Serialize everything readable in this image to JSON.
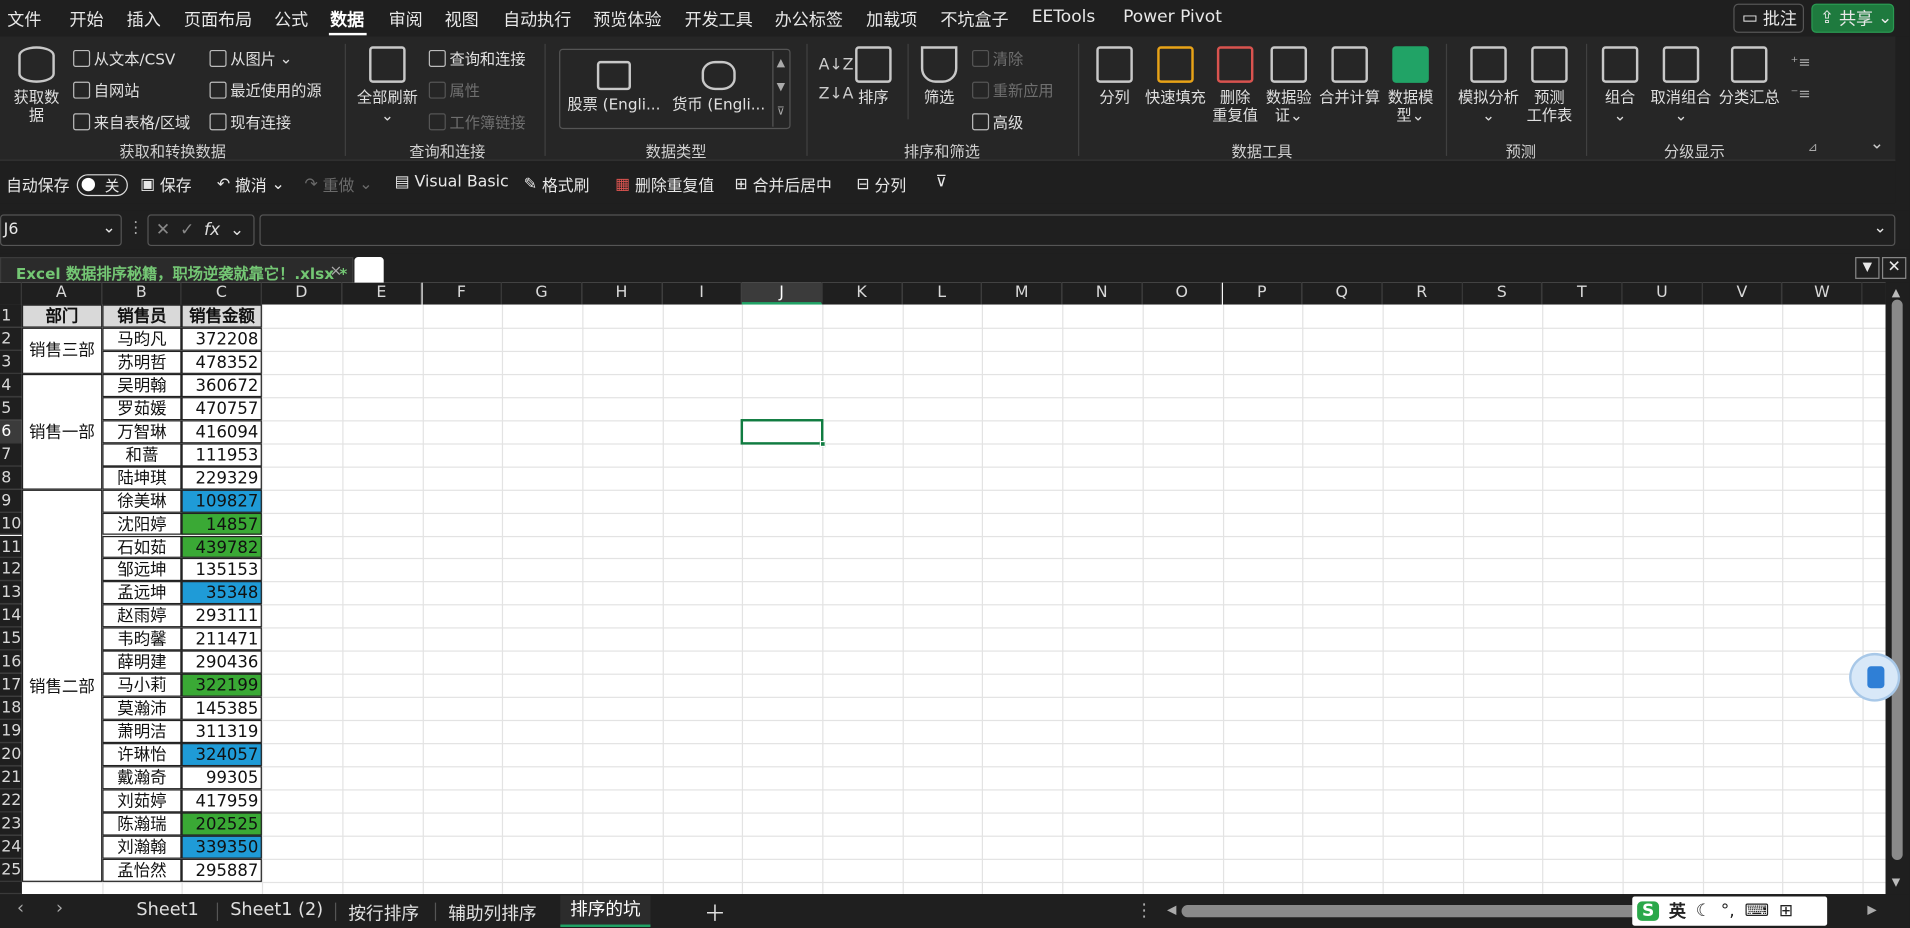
{
  "menu": {
    "items": [
      "文件",
      "开始",
      "插入",
      "页面布局",
      "公式",
      "数据",
      "审阅",
      "视图",
      "自动执行",
      "预览体验",
      "开发工具",
      "办公标签",
      "加载项",
      "不坑盒子",
      "EETools",
      "Power Pivot"
    ],
    "active": "数据",
    "comment_btn": "批注",
    "share_btn": "共享"
  },
  "ribbon": {
    "get_data": "获取数\n据",
    "from_text_csv": "从文本/CSV",
    "from_web": "自网站",
    "from_table": "来自表格/区域",
    "from_picture": "从图片",
    "recent_sources": "最近使用的源",
    "existing_conn": "现有连接",
    "group_get": "获取和转换数据",
    "refresh_all": "全部刷新",
    "queries_conn": "查询和连接",
    "properties": "属性",
    "workbook_links": "工作簿链接",
    "group_query": "查询和连接",
    "stocks": "股票 (Engli...",
    "currency": "货币 (Engli...",
    "group_datatype": "数据类型",
    "sort": "排序",
    "filter": "筛选",
    "clear": "清除",
    "reapply": "重新应用",
    "advanced": "高级",
    "group_sortfilter": "排序和筛选",
    "text_to_cols": "分列",
    "flash_fill": "快速填充",
    "remove_dup": "删除\n重复值",
    "data_validation": "数据验\n证",
    "consolidate": "合并计算",
    "data_model": "数据模\n型",
    "group_tools": "数据工具",
    "what_if": "模拟分析",
    "forecast": "预测\n工作表",
    "group_forecast": "预测",
    "group_btn": "组合",
    "ungroup": "取消组合",
    "subtotal": "分类汇总",
    "group_outline": "分级显示"
  },
  "qat": {
    "autosave": "自动保存",
    "toggle": "关",
    "save": "保存",
    "undo": "撤消",
    "redo": "重做",
    "vba": "Visual Basic",
    "format_painter": "格式刷",
    "remove_dup": "删除重复值",
    "merge_center": "合并后居中",
    "split": "分列"
  },
  "formula": {
    "namebox": "J6",
    "fx": "fx",
    "value": ""
  },
  "workbook": {
    "title": "Excel 数据排序秘籍，职场逆袭就靠它！.xlsx *"
  },
  "columns": [
    "A",
    "B",
    "C",
    "D",
    "E",
    "F",
    "G",
    "H",
    "I",
    "J",
    "K",
    "L",
    "M",
    "N",
    "O",
    "P",
    "Q",
    "R",
    "S",
    "T",
    "U",
    "V",
    "W"
  ],
  "selected_col": "J",
  "selected_row": "6",
  "rows": [
    "1",
    "2",
    "3",
    "4",
    "5",
    "6",
    "7",
    "8",
    "9",
    "10",
    "11",
    "12",
    "13",
    "14",
    "15",
    "16",
    "17",
    "18",
    "19",
    "20",
    "21",
    "22",
    "23",
    "24",
    "25"
  ],
  "table": {
    "headers": [
      "部门",
      "销售员",
      "销售金额"
    ],
    "depts": [
      {
        "name": "销售三部"
      },
      {
        "name": "销售一部"
      },
      {
        "name": "销售二部"
      }
    ],
    "records": [
      {
        "name": "马昀凡",
        "amount": "372208",
        "fill": ""
      },
      {
        "name": "苏明哲",
        "amount": "478352",
        "fill": ""
      },
      {
        "name": "吴明翰",
        "amount": "360672",
        "fill": ""
      },
      {
        "name": "罗茹媛",
        "amount": "470757",
        "fill": ""
      },
      {
        "name": "万智琳",
        "amount": "416094",
        "fill": ""
      },
      {
        "name": "和蔷",
        "amount": "111953",
        "fill": ""
      },
      {
        "name": "陆坤琪",
        "amount": "229329",
        "fill": ""
      },
      {
        "name": "徐美琳",
        "amount": "109827",
        "fill": "#1f9bd7"
      },
      {
        "name": "沈阳婷",
        "amount": "14857",
        "fill": "#3aa935"
      },
      {
        "name": "石如茹",
        "amount": "439782",
        "fill": "#3aa935"
      },
      {
        "name": "邹远坤",
        "amount": "135153",
        "fill": ""
      },
      {
        "name": "孟远坤",
        "amount": "35348",
        "fill": "#1f9bd7"
      },
      {
        "name": "赵雨婷",
        "amount": "293111",
        "fill": ""
      },
      {
        "name": "韦昀馨",
        "amount": "211471",
        "fill": ""
      },
      {
        "name": "薛明建",
        "amount": "290436",
        "fill": ""
      },
      {
        "name": "马小莉",
        "amount": "322199",
        "fill": "#3aa935"
      },
      {
        "name": "莫瀚沛",
        "amount": "145385",
        "fill": ""
      },
      {
        "name": "萧明洁",
        "amount": "311319",
        "fill": ""
      },
      {
        "name": "许琳怡",
        "amount": "324057",
        "fill": "#1f9bd7"
      },
      {
        "name": "戴瀚奇",
        "amount": "99305",
        "fill": ""
      },
      {
        "name": "刘茹婷",
        "amount": "417959",
        "fill": ""
      },
      {
        "name": "陈瀚瑞",
        "amount": "202525",
        "fill": "#3aa935"
      },
      {
        "name": "刘瀚翰",
        "amount": "339350",
        "fill": "#1f9bd7"
      },
      {
        "name": "孟怡然",
        "amount": "295887",
        "fill": ""
      }
    ]
  },
  "sheets": [
    "Sheet1",
    "Sheet1 (2)",
    "按行排序",
    "辅助列排序",
    "排序的坑"
  ],
  "active_sheet": "排序的坑",
  "tray": {
    "ime": "英"
  },
  "colors": {
    "accent": "#21a366",
    "blue_fill": "#1f9bd7",
    "green_fill": "#3aa935",
    "dark_bg": "#1f1f1f"
  }
}
